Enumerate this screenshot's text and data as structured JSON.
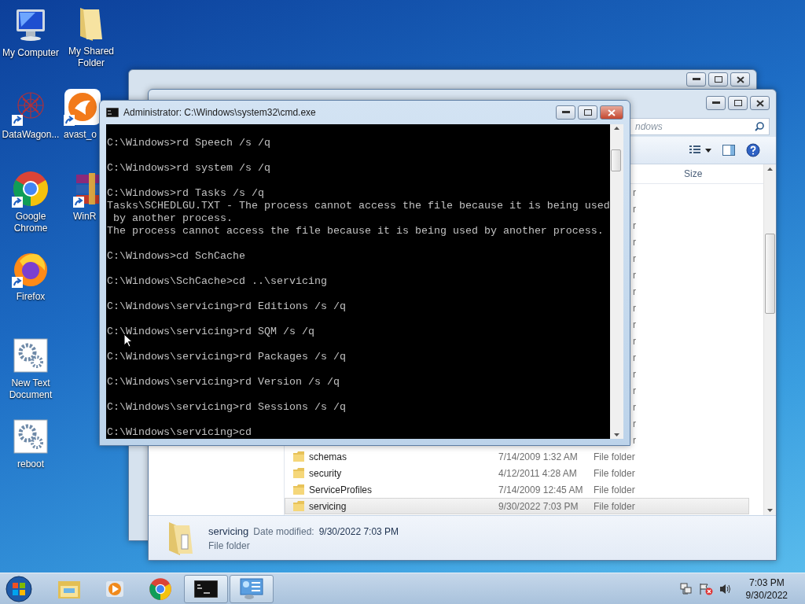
{
  "desktop_icons": [
    {
      "label": "My Computer",
      "kind": "computer",
      "shortcut": false
    },
    {
      "label": "My Shared Folder",
      "kind": "folder",
      "shortcut": false
    },
    {
      "label": "DataWagon...",
      "kind": "network",
      "shortcut": true
    },
    {
      "label": "avast_o",
      "kind": "avast",
      "shortcut": true
    },
    {
      "label": "Google Chrome",
      "kind": "chrome",
      "shortcut": true
    },
    {
      "label": "WinR",
      "kind": "winrar",
      "shortcut": true
    },
    {
      "label": "Firefox",
      "kind": "firefox",
      "shortcut": true
    },
    {
      "label": "New Text Document",
      "kind": "gears",
      "shortcut": false
    },
    {
      "label": "reboot",
      "kind": "gears",
      "shortcut": false
    }
  ],
  "explorer": {
    "search_text": "ndows",
    "column": "Size",
    "rows": [
      {
        "kind": "partial",
        "type": "r",
        "selected": false
      },
      {
        "kind": "partial",
        "type": "r",
        "selected": false
      },
      {
        "kind": "partial",
        "type": "r",
        "selected": false
      },
      {
        "kind": "partial",
        "type": "r",
        "selected": false
      },
      {
        "kind": "partial",
        "type": "r",
        "selected": false
      },
      {
        "kind": "partial",
        "type": "r",
        "selected": false
      },
      {
        "kind": "partial",
        "type": "r",
        "selected": false
      },
      {
        "kind": "partial",
        "type": "r",
        "selected": false
      },
      {
        "kind": "partial",
        "type": "r",
        "selected": false
      },
      {
        "kind": "partial",
        "type": "r",
        "selected": false
      },
      {
        "kind": "partial",
        "type": "r",
        "selected": false
      },
      {
        "kind": "partial",
        "type": "r",
        "selected": false
      },
      {
        "kind": "partial",
        "type": "r",
        "selected": false
      },
      {
        "kind": "partial",
        "type": "r",
        "selected": false
      },
      {
        "kind": "partial",
        "type": "r",
        "selected": false
      },
      {
        "kind": "partial",
        "type": "r",
        "selected": false
      },
      {
        "kind": "full",
        "name": "schemas",
        "date": "7/14/2009 1:32 AM",
        "type": "File folder",
        "selected": false
      },
      {
        "kind": "full",
        "name": "security",
        "date": "4/12/2011 4:28 AM",
        "type": "File folder",
        "selected": false
      },
      {
        "kind": "full",
        "name": "ServiceProfiles",
        "date": "7/14/2009 12:45 AM",
        "type": "File folder",
        "selected": false
      },
      {
        "kind": "full",
        "name": "servicing",
        "date": "9/30/2022 7:03 PM",
        "type": "File folder",
        "selected": true
      }
    ],
    "details": {
      "name": "servicing",
      "date_label": "Date modified:",
      "date": "9/30/2022 7:03 PM",
      "type": "File folder"
    }
  },
  "cmd": {
    "title": "Administrator: C:\\Windows\\system32\\cmd.exe",
    "blocks": [
      [
        "C:\\Windows>rd Speech /s /q"
      ],
      [
        "C:\\Windows>rd system /s /q"
      ],
      [
        "C:\\Windows>rd Tasks /s /q",
        "Tasks\\SCHEDLGU.TXT - The process cannot access the file because it is being used",
        " by another process.",
        "The process cannot access the file because it is being used by another process."
      ],
      [
        "C:\\Windows>cd SchCache"
      ],
      [
        "C:\\Windows\\SchCache>cd ..\\servicing"
      ],
      [
        "C:\\Windows\\servicing>rd Editions /s /q"
      ],
      [
        "C:\\Windows\\servicing>rd SQM /s /q"
      ],
      [
        "C:\\Windows\\servicing>rd Packages /s /q"
      ],
      [
        "C:\\Windows\\servicing>rd Version /s /q"
      ],
      [
        "C:\\Windows\\servicing>rd Sessions /s /q"
      ],
      [
        "C:\\Windows\\servicing>cd"
      ]
    ]
  },
  "taskbar": {
    "items": [
      {
        "kind": "explorer",
        "active": false
      },
      {
        "kind": "media",
        "active": false
      },
      {
        "kind": "chrome",
        "active": false
      },
      {
        "kind": "console",
        "active": true
      },
      {
        "kind": "panel",
        "active": true
      }
    ],
    "time": "7:03 PM",
    "date": "9/30/2022"
  }
}
